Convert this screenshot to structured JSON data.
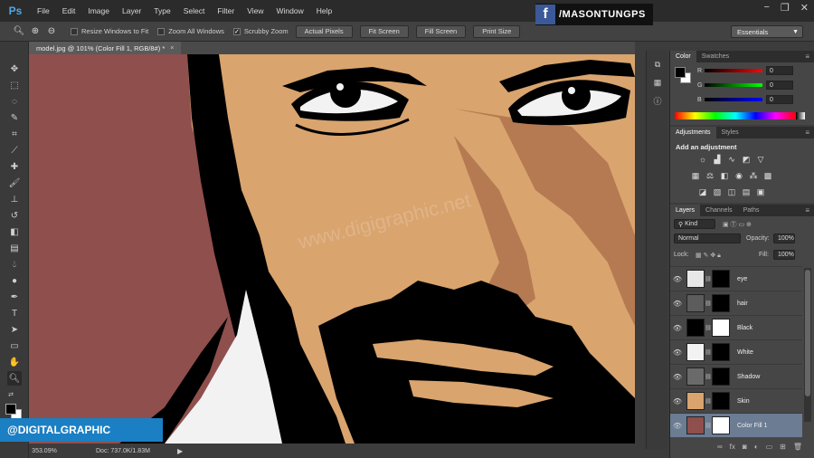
{
  "app": {
    "logo": "Ps",
    "menu": [
      "File",
      "Edit",
      "Image",
      "Layer",
      "Type",
      "Select",
      "Filter",
      "View",
      "Window",
      "Help"
    ]
  },
  "brand": {
    "facebook_icon": "f",
    "facebook_handle": "/MASONTUNGPS",
    "badge": "@DIGITALGRAPHIC",
    "watermark": "www.digigraphic.net"
  },
  "window_controls": [
    "−",
    "❐",
    "✕"
  ],
  "options": {
    "resize_windows": "Resize Windows to Fit",
    "zoom_all": "Zoom All Windows",
    "scrubby_zoom": "Scrubby Zoom",
    "buttons": [
      "Actual Pixels",
      "Fit Screen",
      "Fill Screen",
      "Print Size"
    ],
    "workspace": "Essentials"
  },
  "document": {
    "tab_title": "model.jpg @ 101% (Color Fill 1, RGB/8#) *",
    "close": "×"
  },
  "status": {
    "zoom": "353.09%",
    "doc": "Doc: 737.0K/1.83M",
    "arrow": "▶"
  },
  "panels": {
    "color_tabs": [
      "Color",
      "Swatches"
    ],
    "adjustments_tabs": [
      "Adjustments",
      "Styles"
    ],
    "adjustments_title": "Add an adjustment",
    "layers_tabs": [
      "Layers",
      "Channels",
      "Paths"
    ],
    "menu_icon": "≡"
  },
  "color": {
    "r_label": "R",
    "g_label": "G",
    "b_label": "B",
    "r": "0",
    "g": "0",
    "b": "0"
  },
  "layers_controls": {
    "kind": "Kind",
    "blend_mode": "Normal",
    "opacity_label": "Opacity:",
    "opacity": "100%",
    "lock_label": "Lock:",
    "fill_label": "Fill:",
    "fill": "100%"
  },
  "layers": [
    {
      "name": "eye",
      "thumb": "#e8e8e8",
      "mask": "#000000"
    },
    {
      "name": "hair",
      "thumb": "#5c5c5c",
      "mask": "#000000"
    },
    {
      "name": "Black",
      "thumb": "#000000",
      "mask": "#ffffff"
    },
    {
      "name": "White",
      "thumb": "#f2f2f2",
      "mask": "#000000"
    },
    {
      "name": "Shadow",
      "thumb": "#6a6a6a",
      "mask": "#000000"
    },
    {
      "name": "Skin",
      "thumb": "#d9a46e",
      "mask": "#000000"
    },
    {
      "name": "Color Fill 1",
      "thumb": "#8f4f4c",
      "mask": "#ffffff"
    }
  ],
  "colors": {
    "background_fill": "#8f4f4c",
    "skin": "#d9a46e",
    "shadow": "#b57a52",
    "ink": "#000000",
    "shirt": "#f2f2f2",
    "selected_layer": "#6b7c93",
    "badge": "#1b7fc4"
  }
}
